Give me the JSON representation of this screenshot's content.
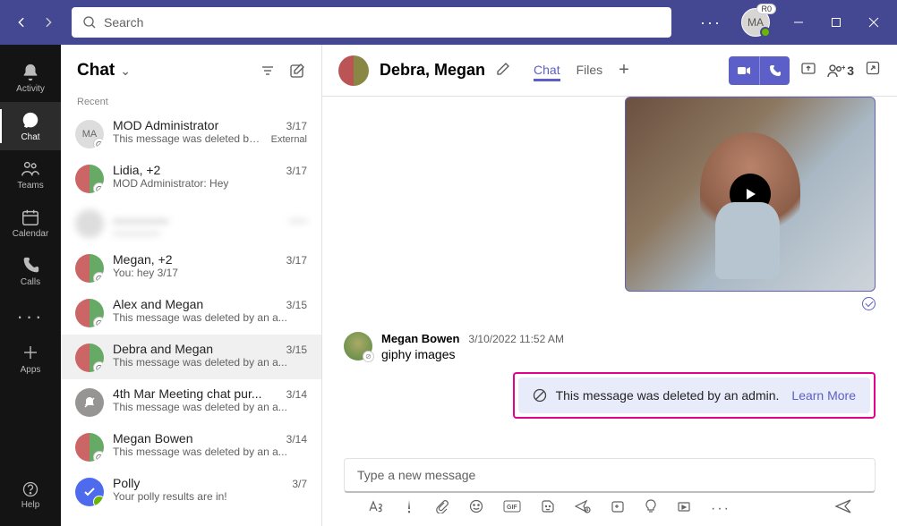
{
  "titlebar": {
    "search_placeholder": "Search",
    "avatar_initials": "MA",
    "avatar_badge": "R0"
  },
  "rail": {
    "items": [
      {
        "label": "Activity"
      },
      {
        "label": "Chat"
      },
      {
        "label": "Teams"
      },
      {
        "label": "Calendar"
      },
      {
        "label": "Calls"
      }
    ],
    "apps_label": "Apps",
    "help_label": "Help"
  },
  "chatlist": {
    "title": "Chat",
    "section": "Recent",
    "items": [
      {
        "avatar": "MA",
        "name": "MOD Administrator",
        "time": "3/17",
        "preview": "This message was deleted by ...",
        "tag": "External"
      },
      {
        "avatar": "grp",
        "name": "Lidia, +2",
        "time": "3/17",
        "preview": "MOD Administrator: Hey",
        "tag": ""
      },
      {
        "avatar": "",
        "name": "________",
        "time": "___",
        "preview": "________",
        "tag": "",
        "blurred": true
      },
      {
        "avatar": "grp",
        "name": "Megan, +2",
        "time": "3/17",
        "preview": "You: hey 3/17",
        "tag": ""
      },
      {
        "avatar": "grp",
        "name": "Alex and Megan",
        "time": "3/15",
        "preview": "This message was deleted by an a...",
        "tag": ""
      },
      {
        "avatar": "grp",
        "name": "Debra and Megan",
        "time": "3/15",
        "preview": "This message was deleted by an a...",
        "tag": "",
        "active": true
      },
      {
        "avatar": "bell",
        "name": "4th Mar Meeting chat pur...",
        "time": "3/14",
        "preview": "This message was deleted by an a...",
        "tag": ""
      },
      {
        "avatar": "p",
        "name": "Megan Bowen",
        "time": "3/14",
        "preview": "This message was deleted by an a...",
        "tag": ""
      },
      {
        "avatar": "polly",
        "name": "Polly",
        "time": "3/7",
        "preview": "Your polly results are in!",
        "tag": ""
      }
    ]
  },
  "convo": {
    "title": "Debra, Megan",
    "tabs": {
      "chat": "Chat",
      "files": "Files"
    },
    "people_count": "3",
    "message": {
      "sender": "Megan Bowen",
      "time": "3/10/2022 11:52 AM",
      "text": "giphy images"
    },
    "deleted_notice": "This message was deleted by an admin.",
    "learn_more": "Learn More",
    "compose_placeholder": "Type a new message"
  }
}
